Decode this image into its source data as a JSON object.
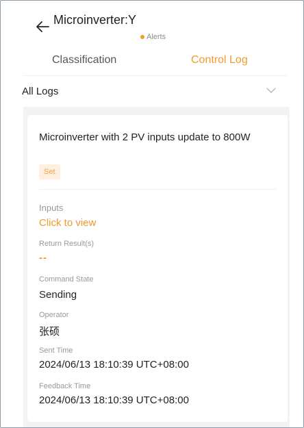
{
  "header": {
    "title": "Microinverter:Y",
    "alerts_label": "Alerts",
    "alerts_dot_color": "#f39a2c"
  },
  "tabs": [
    {
      "label": "Classification",
      "active": false
    },
    {
      "label": "Control Log",
      "active": true
    }
  ],
  "filter": {
    "selected": "All Logs"
  },
  "log": {
    "title": "Microinverter with 2 PV inputs update to 800W",
    "badge": "Set",
    "inputs_label": "Inputs",
    "inputs_value": "Click to view",
    "return_label": "Return Result(s)",
    "return_value": "--",
    "state_label": "Command State",
    "state_value": "Sending",
    "operator_label": "Operator",
    "operator_value": "张硕",
    "sent_label": "Sent Time",
    "sent_value": "2024/06/13 18:10:39 UTC+08:00",
    "feedback_label": "Feedback Time",
    "feedback_value": "2024/06/13 18:10:39 UTC+08:00"
  },
  "colors": {
    "accent": "#f39a2c",
    "badge_bg": "#fdf0e0"
  },
  "icons": {
    "back": "arrow-left-icon",
    "filter": "chevron-down-icon"
  }
}
